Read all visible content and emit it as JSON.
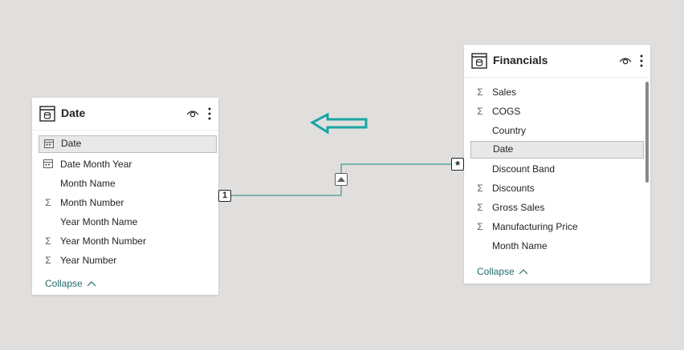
{
  "colors": {
    "canvas": "#e1dfdd",
    "relationship_line": "#5aa39c",
    "annotation_arrow": "#1aa5a5",
    "collapse_link": "#1e6e6a"
  },
  "date_table": {
    "title": "Date",
    "icons": [
      "table-icon",
      "eye-icon",
      "more-options-icon"
    ],
    "fields": [
      {
        "label": "Date",
        "icon": "calendar-icon",
        "selected": true
      },
      {
        "label": "Date Month Year",
        "icon": "calendar-icon"
      },
      {
        "label": "Month Name",
        "icon": ""
      },
      {
        "label": "Month Number",
        "icon": "sigma-icon",
        "glyph": "Σ"
      },
      {
        "label": "Year Month Name",
        "icon": ""
      },
      {
        "label": "Year Month Number",
        "icon": "sigma-icon",
        "glyph": "Σ"
      },
      {
        "label": "Year Number",
        "icon": "sigma-icon",
        "glyph": "Σ"
      }
    ],
    "collapse_label": "Collapse"
  },
  "financials_table": {
    "title": "Financials",
    "icons": [
      "table-icon",
      "eye-icon",
      "more-options-icon"
    ],
    "fields": [
      {
        "label": "Sales",
        "icon": "sigma-icon",
        "glyph": "Σ"
      },
      {
        "label": "COGS",
        "icon": "sigma-icon",
        "glyph": "Σ"
      },
      {
        "label": "Country",
        "icon": ""
      },
      {
        "label": "Date",
        "icon": "",
        "selected": true
      },
      {
        "label": "Discount Band",
        "icon": ""
      },
      {
        "label": "Discounts",
        "icon": "sigma-icon",
        "glyph": "Σ"
      },
      {
        "label": "Gross Sales",
        "icon": "sigma-icon",
        "glyph": "Σ"
      },
      {
        "label": "Manufacturing Price",
        "icon": "sigma-icon",
        "glyph": "Σ"
      },
      {
        "label": "Month Name",
        "icon": ""
      }
    ],
    "collapse_label": "Collapse"
  },
  "relationship": {
    "one_side": "1",
    "many_side": "*",
    "cross_filter": "single"
  }
}
